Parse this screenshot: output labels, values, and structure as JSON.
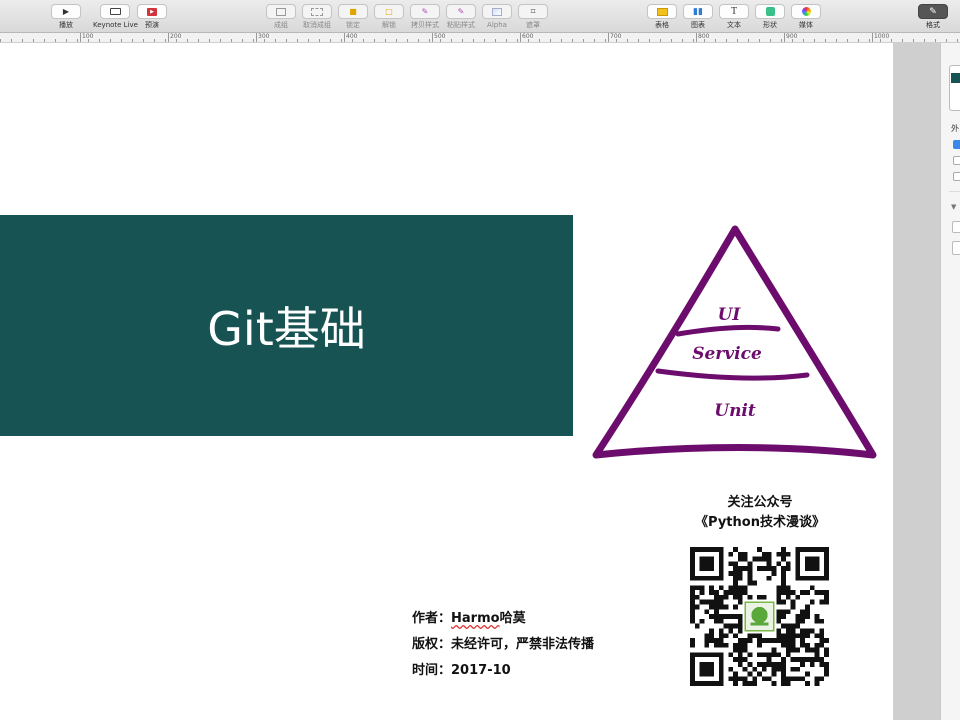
{
  "toolbar": {
    "play": "播放",
    "keynote_live": "Keynote Live",
    "preview": "预演",
    "group": "成组",
    "ungroup": "取消成组",
    "lock": "锁定",
    "unlock": "解锁",
    "copy_style": "拷贝样式",
    "paste_style": "粘贴样式",
    "alpha": "Alpha",
    "crop": "遮罩",
    "table": "表格",
    "chart": "图表",
    "text": "文本",
    "shape": "形状",
    "media": "媒体",
    "format": "格式"
  },
  "ruler": {
    "marks": [
      "100",
      "200",
      "300",
      "400",
      "500",
      "600",
      "700",
      "800",
      "900",
      "1000"
    ]
  },
  "slide": {
    "title": "Git基础",
    "banner_color": "#185353",
    "pyramid": {
      "color": "#6c0c6c",
      "layers": [
        "UI",
        "Service",
        "Unit"
      ]
    },
    "qr_caption_line1": "关注公众号",
    "qr_caption_line2": "《Python技术漫谈》",
    "author_label": "作者：",
    "author_name": "Harmo",
    "author_name_cn": "哈莫",
    "copyright_label": "版权：",
    "copyright_text": "未经许可，严禁非法传播",
    "time_label": "时间：",
    "time_value": "2017-10"
  },
  "inspector": {
    "section_label": "外"
  }
}
